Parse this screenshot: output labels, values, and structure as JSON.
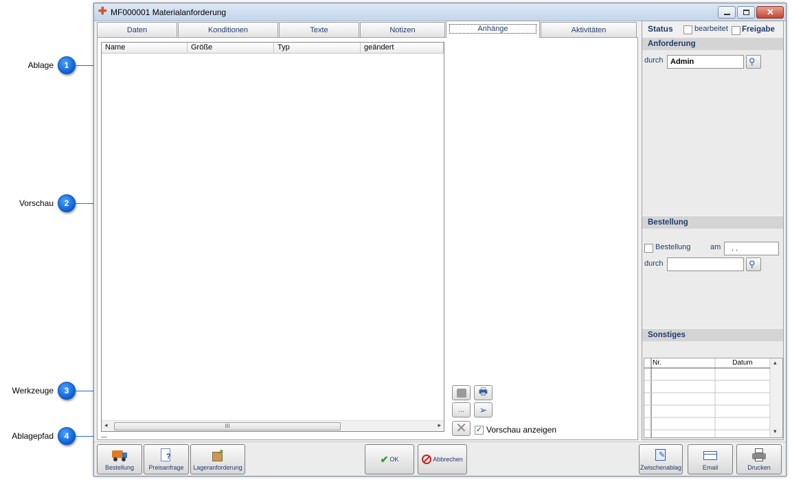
{
  "callouts": [
    {
      "number": "1",
      "label": "Ablage"
    },
    {
      "number": "2",
      "label": "Vorschau"
    },
    {
      "number": "3",
      "label": "Werkzeuge"
    },
    {
      "number": "4",
      "label": "Ablagepfad"
    }
  ],
  "window": {
    "title": "MF000001 Materialanforderung",
    "tabs": [
      "Daten",
      "Konditionen",
      "Texte",
      "Notizen",
      "Anhänge",
      "Aktivitäten"
    ],
    "active_tab": "Anhänge"
  },
  "attachments": {
    "columns": [
      "Name",
      "Größe",
      "Typ",
      "geändert"
    ],
    "scroll_grip": "III",
    "path_text": "—"
  },
  "tools": {
    "more_label": "...",
    "preview_checkbox_label": "Vorschau anzeigen",
    "preview_checked": true
  },
  "status": {
    "title": "Status",
    "bearbeitet_label": "bearbeitet",
    "freigabe_label": "Freigabe",
    "anforderung": {
      "heading": "Anforderung",
      "durch_label": "durch",
      "durch_value": "Admin"
    },
    "bestellung": {
      "heading": "Bestellung",
      "checkbox_label": "Bestellung",
      "am_label": "am",
      "am_value": ". .",
      "durch_label": "durch",
      "durch_value": ""
    },
    "sonstiges": {
      "heading": "Sonstiges",
      "columns": [
        "Nr.",
        "Datum"
      ]
    }
  },
  "bottom_buttons": {
    "bestellung": "Bestellung",
    "preisanfrage": "Preisanfrage",
    "lageranforderung": "Lageranforderung",
    "ok": "OK",
    "abbrechen": "Abbrechen",
    "zwischenablage": "Zwischenablag",
    "email": "Email",
    "drucken": "Drucken"
  },
  "colors": {
    "callout_blue": "#0a5fd8",
    "label_blue": "#1f3d6e"
  }
}
